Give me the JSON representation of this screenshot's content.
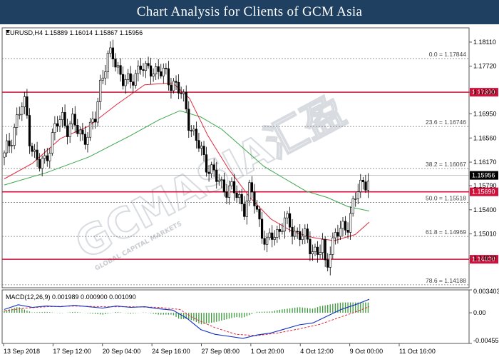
{
  "header": {
    "title": "Chart Analysis for Clients of GCM Asia"
  },
  "watermark": {
    "brand": "GCMASIA汇盈",
    "tagline": "GLOBAL CAPITAL MARKETS"
  },
  "chart_data": {
    "type": "candlestick",
    "symbol_label": "EURUSD,H4  1.15889 1.16014 1.15867 1.15956",
    "price_axis": {
      "ylim": [
        1.414,
        1.1834
      ],
      "ticks": [
        "1.18110",
        "1.17720",
        "1.17300",
        "1.16950",
        "1.16560",
        "1.16170",
        "1.15790",
        "1.15400",
        "1.15010",
        "1.14620"
      ],
      "current_price": "1.15956"
    },
    "x_tick_labels": [
      "13 Sep 2018",
      "17 Sep 12:00",
      "20 Sep 04:00",
      "24 Sep 16:00",
      "27 Sep 08:00",
      "1 Oct 20:00",
      "4 Oct 12:00",
      "9 Oct 00:00",
      "11 Oct 16:00"
    ],
    "key_levels": [
      {
        "value": 1.173,
        "label": "1.17300",
        "color": "#d0103a"
      },
      {
        "value": 1.1569,
        "label": "1.15690",
        "color": "#d0103a"
      },
      {
        "value": 1.146,
        "label": "1.14600",
        "color": "#d0103a"
      }
    ],
    "fibonacci": [
      {
        "value": 1.17844,
        "label": "0.0 = 1.17844"
      },
      {
        "value": 1.16746,
        "label": "23.6 = 1.16746"
      },
      {
        "value": 1.16067,
        "label": "38.2 = 1.16067"
      },
      {
        "value": 1.15518,
        "label": "50.0 = 1.15518"
      },
      {
        "value": 1.14969,
        "label": "61.8 = 1.14969"
      },
      {
        "value": 1.14188,
        "label": "78.6 = 1.14188"
      }
    ],
    "price_path": [
      [
        0,
        1.1625
      ],
      [
        8,
        1.165
      ],
      [
        16,
        1.168
      ],
      [
        24,
        1.1705
      ],
      [
        30,
        1.171
      ],
      [
        36,
        1.166
      ],
      [
        42,
        1.163
      ],
      [
        50,
        1.161
      ],
      [
        58,
        1.162
      ],
      [
        66,
        1.165
      ],
      [
        74,
        1.1675
      ],
      [
        82,
        1.169
      ],
      [
        90,
        1.1675
      ],
      [
        98,
        1.168
      ],
      [
        106,
        1.1665
      ],
      [
        114,
        1.166
      ],
      [
        122,
        1.1665
      ],
      [
        130,
        1.169
      ],
      [
        138,
        1.1755
      ],
      [
        146,
        1.178
      ],
      [
        154,
        1.179
      ],
      [
        162,
        1.177
      ],
      [
        170,
        1.175
      ],
      [
        178,
        1.174
      ],
      [
        186,
        1.176
      ],
      [
        194,
        1.1775
      ],
      [
        202,
        1.176
      ],
      [
        210,
        1.177
      ],
      [
        218,
        1.1765
      ],
      [
        226,
        1.176
      ],
      [
        234,
        1.175
      ],
      [
        242,
        1.1745
      ],
      [
        250,
        1.173
      ],
      [
        258,
        1.171
      ],
      [
        264,
        1.168
      ],
      [
        270,
        1.166
      ],
      [
        278,
        1.164
      ],
      [
        286,
        1.162
      ],
      [
        294,
        1.1605
      ],
      [
        302,
        1.159
      ],
      [
        310,
        1.158
      ],
      [
        318,
        1.1575
      ],
      [
        326,
        1.157
      ],
      [
        334,
        1.156
      ],
      [
        342,
        1.1545
      ],
      [
        350,
        1.157
      ],
      [
        358,
        1.155
      ],
      [
        366,
        1.151
      ],
      [
        374,
        1.148
      ],
      [
        382,
        1.15
      ],
      [
        390,
        1.1505
      ],
      [
        398,
        1.152
      ],
      [
        406,
        1.1515
      ],
      [
        414,
        1.1505
      ],
      [
        422,
        1.15
      ],
      [
        430,
        1.149
      ],
      [
        438,
        1.148
      ],
      [
        446,
        1.147
      ],
      [
        454,
        1.148
      ],
      [
        458,
        1.144
      ],
      [
        464,
        1.148
      ],
      [
        472,
        1.15
      ],
      [
        480,
        1.1505
      ],
      [
        488,
        1.1515
      ],
      [
        496,
        1.1545
      ],
      [
        504,
        1.157
      ],
      [
        512,
        1.1585
      ],
      [
        520,
        1.1596
      ]
    ],
    "ma_red": [
      [
        0,
        1.159
      ],
      [
        40,
        1.1615
      ],
      [
        80,
        1.1655
      ],
      [
        120,
        1.1675
      ],
      [
        160,
        1.171
      ],
      [
        200,
        1.1742
      ],
      [
        240,
        1.1745
      ],
      [
        264,
        1.172
      ],
      [
        290,
        1.166
      ],
      [
        320,
        1.1605
      ],
      [
        350,
        1.156
      ],
      [
        380,
        1.1525
      ],
      [
        410,
        1.1505
      ],
      [
        440,
        1.1495
      ],
      [
        470,
        1.149
      ],
      [
        500,
        1.15
      ],
      [
        520,
        1.152
      ]
    ],
    "ma_green": [
      [
        0,
        1.158
      ],
      [
        60,
        1.16
      ],
      [
        120,
        1.1625
      ],
      [
        180,
        1.166
      ],
      [
        220,
        1.1685
      ],
      [
        250,
        1.17
      ],
      [
        280,
        1.169
      ],
      [
        310,
        1.167
      ],
      [
        340,
        1.164
      ],
      [
        370,
        1.161
      ],
      [
        400,
        1.159
      ],
      [
        430,
        1.157
      ],
      [
        460,
        1.156
      ],
      [
        490,
        1.1545
      ],
      [
        520,
        1.1538
      ]
    ],
    "macd": {
      "label": "MACD(12,26,9) 0.001989 0.000900 0.001090",
      "ticks": [
        "0.003403",
        "0.00",
        "-0.004557"
      ],
      "ylim": [
        -0.004557,
        0.003403
      ],
      "line": [
        [
          0,
          0.0005
        ],
        [
          20,
          0.0012
        ],
        [
          40,
          0.0008
        ],
        [
          60,
          0.001
        ],
        [
          80,
          0.0009
        ],
        [
          100,
          0.0011
        ],
        [
          120,
          0.0009
        ],
        [
          140,
          0.0007
        ],
        [
          160,
          0.001
        ],
        [
          180,
          0.0008
        ],
        [
          200,
          0.0009
        ],
        [
          220,
          0.0006
        ],
        [
          240,
          0.0004
        ],
        [
          260,
          -0.0008
        ],
        [
          280,
          -0.0025
        ],
        [
          300,
          -0.0032
        ],
        [
          320,
          -0.0035
        ],
        [
          340,
          -0.0038
        ],
        [
          360,
          -0.0033
        ],
        [
          380,
          -0.003
        ],
        [
          400,
          -0.0024
        ],
        [
          420,
          -0.0018
        ],
        [
          440,
          -0.0015
        ],
        [
          460,
          -0.0005
        ],
        [
          480,
          0.0005
        ],
        [
          500,
          0.0012
        ],
        [
          520,
          0.002
        ]
      ],
      "signal": [
        [
          0,
          0.0003
        ],
        [
          30,
          0.0007
        ],
        [
          60,
          0.0009
        ],
        [
          100,
          0.001
        ],
        [
          140,
          0.0009
        ],
        [
          180,
          0.0009
        ],
        [
          220,
          0.0008
        ],
        [
          250,
          0.0005
        ],
        [
          270,
          -0.0008
        ],
        [
          300,
          -0.0022
        ],
        [
          330,
          -0.0032
        ],
        [
          360,
          -0.0034
        ],
        [
          390,
          -0.003
        ],
        [
          420,
          -0.0024
        ],
        [
          450,
          -0.0017
        ],
        [
          480,
          -0.0006
        ],
        [
          500,
          0.0001
        ],
        [
          520,
          0.0009
        ]
      ],
      "hist_color": "#3a9a3a"
    },
    "colors": {
      "candle_up": "#ffffff",
      "candle_down": "#000000",
      "ma_red": "#e0283a",
      "ma_green": "#3aa64a",
      "macd_line": "#1030c0",
      "macd_signal": "#e0283a"
    }
  }
}
